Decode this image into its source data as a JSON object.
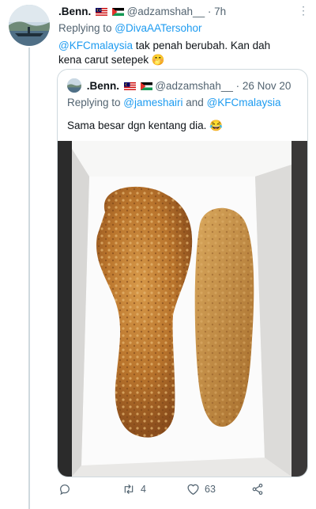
{
  "tweet": {
    "display_name": ".Benn.",
    "handle": "@adzamshah__",
    "separator": "·",
    "time": "7h",
    "replying_prefix": "Replying to ",
    "replying_to": "@DivaAATersohor",
    "mention": "@KFCmalaysia",
    "text": " tak penah berubah. Kan dah kena carut setepek",
    "text_emoji": "🤭",
    "more_icon": "⋮"
  },
  "quoted": {
    "display_name": ".Benn.",
    "handle": "@adzamshah__",
    "separator": "·",
    "date": "26 Nov 20",
    "replying_prefix": "Replying to ",
    "replying_to_1": "@jameshairi",
    "replying_and": " and ",
    "replying_to_2": "@KFCmalaysia",
    "text": "Sama besar dgn kentang dia.",
    "text_emoji": "😂"
  },
  "actions": {
    "reply_count": "",
    "retweet_count": "4",
    "like_count": "63"
  },
  "colors": {
    "link": "#1d9bf0",
    "muted": "#536471",
    "border": "#cfd9de"
  }
}
